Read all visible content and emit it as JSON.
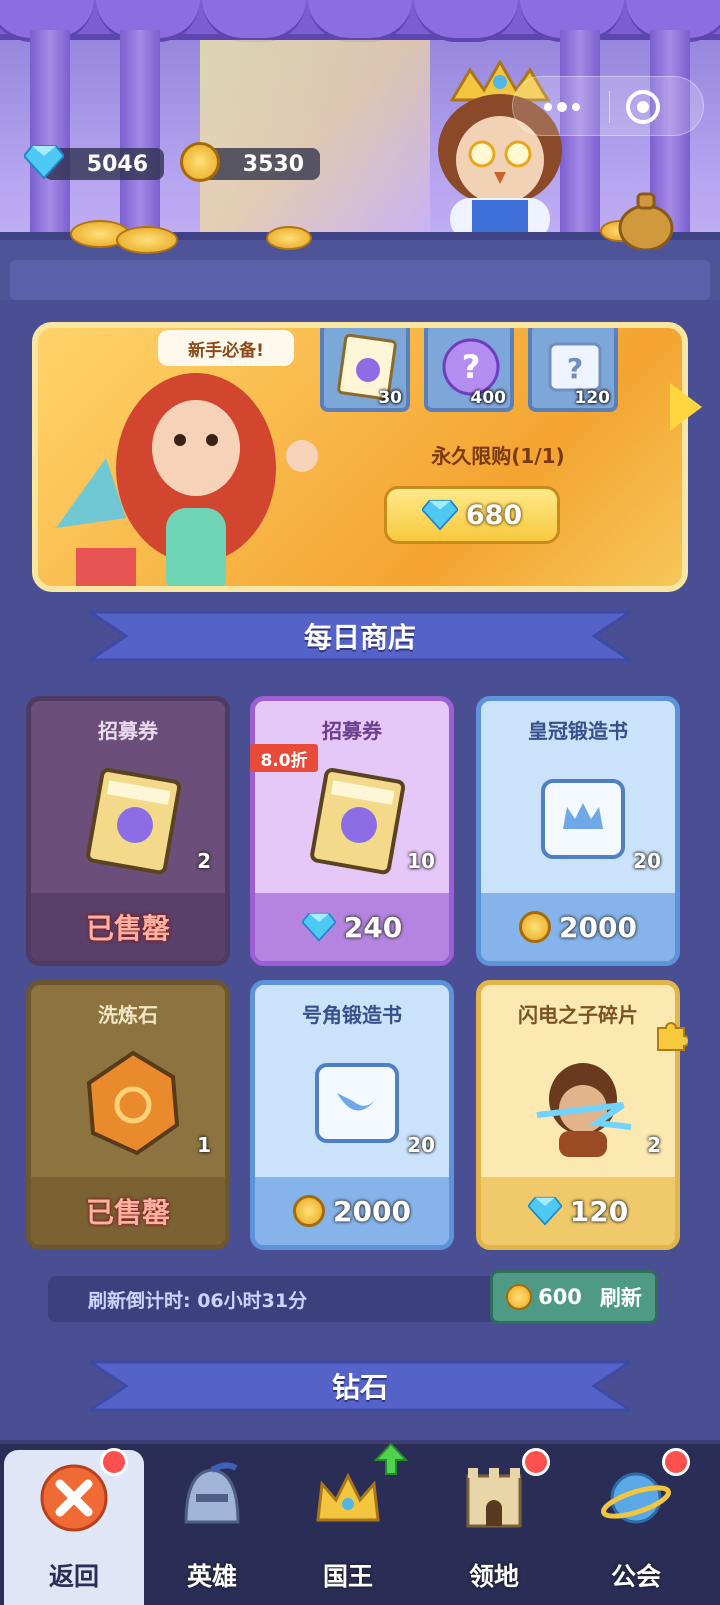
{
  "currency": {
    "diamonds": "5046",
    "gold": "3530"
  },
  "banner": {
    "tag": "新手必备!",
    "items": [
      {
        "name": "recruit-ticket",
        "qty": "30"
      },
      {
        "name": "mystery-orb",
        "qty": "400"
      },
      {
        "name": "mystery-scroll",
        "qty": "120"
      }
    ],
    "limit": "永久限购(1/1)",
    "price": "680"
  },
  "daily_shop": {
    "title": "每日商店",
    "discount": "8.0折",
    "cards": [
      {
        "title": "招募券",
        "qty": "2",
        "price": "已售罄",
        "currency": "sold"
      },
      {
        "title": "招募券",
        "qty": "10",
        "price": "240",
        "currency": "diamond"
      },
      {
        "title": "皇冠锻造书",
        "qty": "20",
        "price": "2000",
        "currency": "gold"
      },
      {
        "title": "洗炼石",
        "qty": "1",
        "price": "已售罄",
        "currency": "sold"
      },
      {
        "title": "号角锻造书",
        "qty": "20",
        "price": "2000",
        "currency": "gold"
      },
      {
        "title": "闪电之子碎片",
        "qty": "2",
        "price": "120",
        "currency": "diamond"
      }
    ]
  },
  "refresh": {
    "countdown": "刷新倒计时: 06小时31分",
    "cost": "600",
    "label": "刷新"
  },
  "diamond_section": {
    "title": "钻石"
  },
  "nav": [
    {
      "label": "返回",
      "icon": "close-icon"
    },
    {
      "label": "英雄",
      "icon": "helmet-icon"
    },
    {
      "label": "国王",
      "icon": "crown-icon"
    },
    {
      "label": "领地",
      "icon": "castle-icon"
    },
    {
      "label": "公会",
      "icon": "planet-icon"
    }
  ],
  "colors": {
    "accent_gold": "#ffd640",
    "badge_red": "#ff5050",
    "bg": "#4a4e92"
  }
}
